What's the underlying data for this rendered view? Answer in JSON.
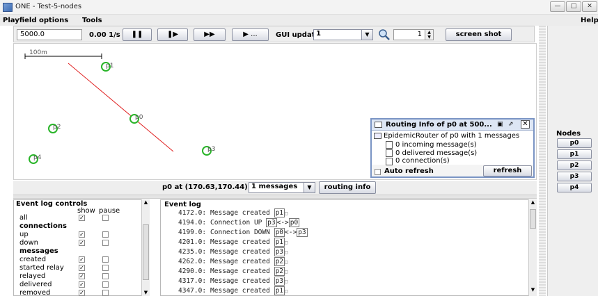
{
  "window": {
    "title": "ONE - Test-5-nodes",
    "controls": [
      "minimize-icon",
      "maximize-icon",
      "close-icon"
    ]
  },
  "menu": {
    "items": [
      "Playfield options",
      "Tools"
    ],
    "help": "Help"
  },
  "toolbar": {
    "sim_time": "5000.0",
    "speed": "0.00 1/s",
    "gui_update_label": "GUI update:",
    "gui_update_value": "1",
    "zoom_value": "1",
    "screenshot_label": "screen shot",
    "buttons": [
      "pause-icon",
      "step-icon",
      "fast-forward-icon",
      "play-until-icon"
    ],
    "play_until_dots": "..."
  },
  "playfield": {
    "scale_label": "100m",
    "nodes": [
      {
        "id": "p1",
        "label": "p1"
      },
      {
        "id": "p0",
        "label": "p0"
      },
      {
        "id": "p2",
        "label": "p2"
      },
      {
        "id": "p3",
        "label": "p3"
      },
      {
        "id": "p4",
        "label": "p4"
      }
    ],
    "path_color": "#e02020",
    "node_color": "#28b428"
  },
  "routing_info": {
    "title": "Routing Info of p0 at 500...",
    "root": "EpidemicRouter of p0 with 1 messages",
    "children": [
      "0 incoming message(s)",
      "0 delivered message(s)",
      "0 connection(s)"
    ],
    "auto_refresh_label": "Auto refresh",
    "refresh_label": "refresh"
  },
  "status": {
    "location": "p0 at (170.63,170.44)",
    "messages_select": "1 messages",
    "routing_info_button": "routing info"
  },
  "event_controls": {
    "title": "Event log controls",
    "col_show": "show",
    "col_pause": "pause",
    "rows": [
      {
        "label": "all",
        "header": false,
        "show": true,
        "pause": false
      },
      {
        "label": "connections",
        "header": true
      },
      {
        "label": "up",
        "header": false,
        "show": true,
        "pause": false
      },
      {
        "label": "down",
        "header": false,
        "show": true,
        "pause": false
      },
      {
        "label": "messages",
        "header": true
      },
      {
        "label": "created",
        "header": false,
        "show": true,
        "pause": false
      },
      {
        "label": "started relay",
        "header": false,
        "show": true,
        "pause": false
      },
      {
        "label": "relayed",
        "header": false,
        "show": true,
        "pause": false
      },
      {
        "label": "delivered",
        "header": false,
        "show": true,
        "pause": false
      },
      {
        "label": "removed",
        "header": false,
        "show": true,
        "pause": false
      }
    ]
  },
  "event_log": {
    "title": "Event log",
    "lines": [
      {
        "time": "4172.0:",
        "text": "Message created",
        "nodes": [
          "p1"
        ],
        "sep": "",
        "tail": "□"
      },
      {
        "time": "4194.0:",
        "text": "Connection UP",
        "nodes": [
          "p3",
          "p0"
        ],
        "sep": "<->",
        "tail": ""
      },
      {
        "time": "4199.0:",
        "text": "Connection DOWN",
        "nodes": [
          "p0",
          "p3"
        ],
        "sep": "<->",
        "tail": ""
      },
      {
        "time": "4201.0:",
        "text": "Message created",
        "nodes": [
          "p1"
        ],
        "sep": "",
        "tail": "□"
      },
      {
        "time": "4235.0:",
        "text": "Message created",
        "nodes": [
          "p3"
        ],
        "sep": "",
        "tail": "□"
      },
      {
        "time": "4262.0:",
        "text": "Message created",
        "nodes": [
          "p2"
        ],
        "sep": "",
        "tail": "□"
      },
      {
        "time": "4290.0:",
        "text": "Message created",
        "nodes": [
          "p2"
        ],
        "sep": "",
        "tail": "□"
      },
      {
        "time": "4317.0:",
        "text": "Message created",
        "nodes": [
          "p3"
        ],
        "sep": "",
        "tail": "□"
      },
      {
        "time": "4347.0:",
        "text": "Message created",
        "nodes": [
          "p1"
        ],
        "sep": "",
        "tail": "□"
      }
    ]
  },
  "nodes_panel": {
    "title": "Nodes",
    "buttons": [
      "p0",
      "p1",
      "p2",
      "p3",
      "p4"
    ]
  }
}
